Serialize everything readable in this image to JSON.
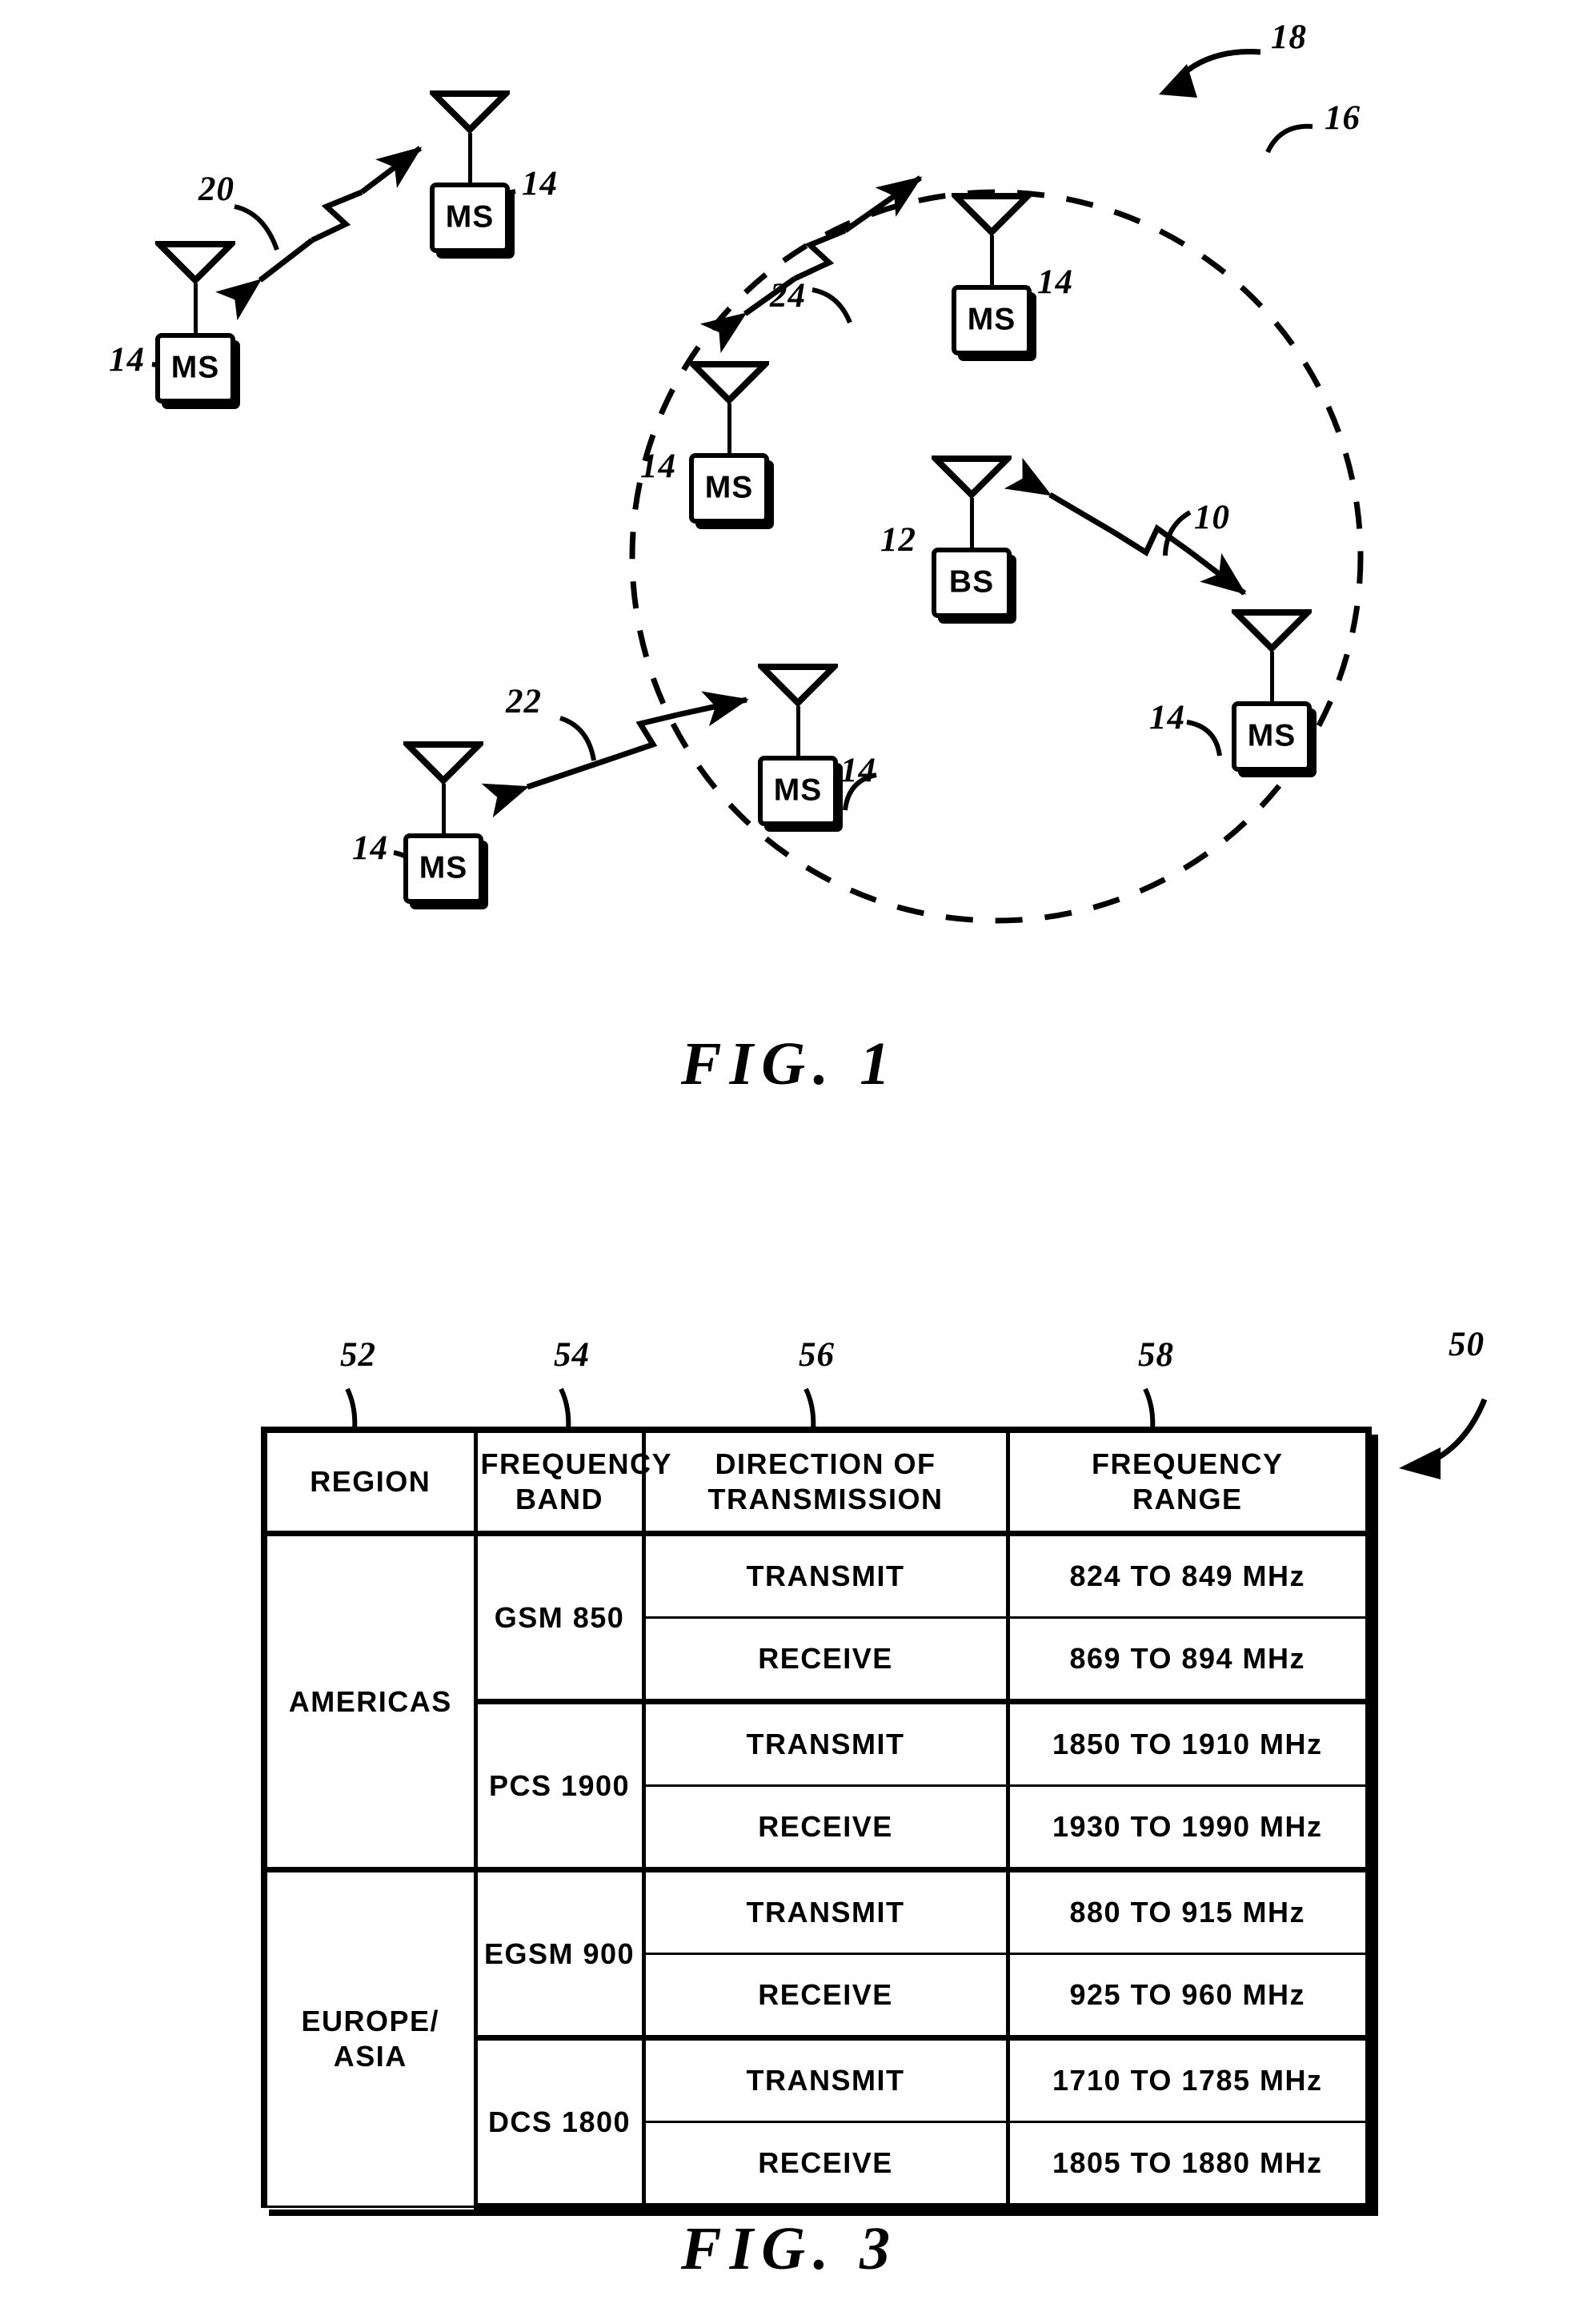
{
  "figures": {
    "fig1": {
      "caption": "FIG. 1",
      "cell_boundary_ref": "16",
      "system_ref": "18",
      "base_station_ref": "12",
      "base_station_label": "BS",
      "mobile_station_label": "MS",
      "mobile_station_ref": "14",
      "links": [
        {
          "ref": "20",
          "description": "mobile-to-mobile link outside cell"
        },
        {
          "ref": "24",
          "description": "mobile-to-mobile link inside cell"
        },
        {
          "ref": "22",
          "description": "mobile-to-mobile link crossing cell boundary"
        },
        {
          "ref": "10",
          "description": "base-station-to-mobile link"
        }
      ],
      "mobile_stations": [
        {
          "id": "ms-upper-left-far",
          "label": "MS",
          "ref": "14"
        },
        {
          "id": "ms-upper-left-near",
          "label": "MS",
          "ref": "14"
        },
        {
          "id": "ms-cell-top",
          "label": "MS",
          "ref": "14"
        },
        {
          "id": "ms-cell-left",
          "label": "MS",
          "ref": "14"
        },
        {
          "id": "ms-cell-bottom-right",
          "label": "MS",
          "ref": "14"
        },
        {
          "id": "ms-cell-lower-left",
          "label": "MS",
          "ref": "14"
        },
        {
          "id": "ms-outside-lower-left",
          "label": "MS",
          "ref": "14"
        }
      ]
    },
    "fig3": {
      "caption": "FIG. 3",
      "table_ref": "50",
      "column_refs": [
        "52",
        "54",
        "56",
        "58"
      ],
      "headers": [
        "REGION",
        "FREQUENCY\nBAND",
        "DIRECTION OF\nTRANSMISSION",
        "FREQUENCY\nRANGE"
      ],
      "header_lines": {
        "region": [
          "REGION"
        ],
        "frequency_band": [
          "FREQUENCY",
          "BAND"
        ],
        "direction": [
          "DIRECTION OF",
          "TRANSMISSION"
        ],
        "range": [
          "FREQUENCY",
          "RANGE"
        ]
      },
      "rows": [
        {
          "region": "AMERICAS",
          "band": "GSM 850",
          "direction": "TRANSMIT",
          "range": "824 TO 849 MHz"
        },
        {
          "region": "AMERICAS",
          "band": "GSM 850",
          "direction": "RECEIVE",
          "range": "869 TO 894 MHz"
        },
        {
          "region": "AMERICAS",
          "band": "PCS 1900",
          "direction": "TRANSMIT",
          "range": "1850 TO 1910 MHz"
        },
        {
          "region": "AMERICAS",
          "band": "PCS 1900",
          "direction": "RECEIVE",
          "range": "1930 TO 1990 MHz"
        },
        {
          "region": "EUROPE/ ASIA",
          "band": "EGSM 900",
          "direction": "TRANSMIT",
          "range": "880 TO 915 MHz"
        },
        {
          "region": "EUROPE/ ASIA",
          "band": "EGSM 900",
          "direction": "RECEIVE",
          "range": "925 TO 960 MHz"
        },
        {
          "region": "EUROPE/ ASIA",
          "band": "DCS 1800",
          "direction": "TRANSMIT",
          "range": "1710 TO 1785 MHz"
        },
        {
          "region": "EUROPE/ ASIA",
          "band": "DCS 1800",
          "direction": "RECEIVE",
          "range": "1805 TO 1880 MHz"
        }
      ],
      "region_labels": {
        "americas": "AMERICAS",
        "europe_asia_line1": "EUROPE/",
        "europe_asia_line2": "ASIA"
      },
      "bands": [
        "GSM 850",
        "PCS 1900",
        "EGSM 900",
        "DCS 1800"
      ],
      "directions": [
        "TRANSMIT",
        "RECEIVE"
      ],
      "ranges": [
        "824 TO 849 MHz",
        "869 TO 894 MHz",
        "1850 TO 1910 MHz",
        "1930 TO 1990 MHz",
        "880 TO 915 MHz",
        "925 TO 960 MHz",
        "1710 TO 1785 MHz",
        "1805 TO 1880 MHz"
      ]
    }
  },
  "colors": {
    "ink": "#000000",
    "paper": "#ffffff"
  }
}
